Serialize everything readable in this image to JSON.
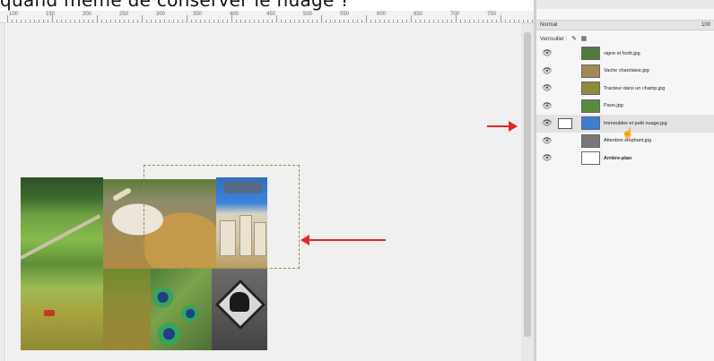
{
  "caption": {
    "text": "quand même de conserver le nuage ?"
  },
  "ruler": {
    "labels": [
      "100",
      "150",
      "200",
      "250",
      "300",
      "350",
      "400",
      "450",
      "500",
      "550",
      "600",
      "650",
      "700",
      "750"
    ]
  },
  "panel": {
    "tabs_label": "Calques",
    "mode_label": "Normal",
    "opacity_label": "100",
    "lock_label": "Verrouiller :",
    "layers": [
      {
        "name": "vigne et forêt.jpg",
        "thumb": "#4f7a3a",
        "selected": false,
        "bold": false
      },
      {
        "name": "Vache charolaise.jpg",
        "thumb": "#a38a55",
        "selected": false,
        "bold": false
      },
      {
        "name": "Tracteur dans un champ.jpg",
        "thumb": "#8e8c38",
        "selected": false,
        "bold": false
      },
      {
        "name": "Paon.jpg",
        "thumb": "#5a8a3c",
        "selected": false,
        "bold": false
      },
      {
        "name": "Immeubles et petit nuage.jpg",
        "thumb": "#3b7fd1",
        "selected": true,
        "bold": false
      },
      {
        "name": "Attention éléphant.jpg",
        "thumb": "#777777",
        "selected": false,
        "bold": false
      },
      {
        "name": "Arrière-plan",
        "thumb": "#ffffff",
        "selected": false,
        "bold": true
      }
    ]
  },
  "colors": {
    "arrow": "#e12828",
    "canvas_bg": "#f0f0f0"
  }
}
